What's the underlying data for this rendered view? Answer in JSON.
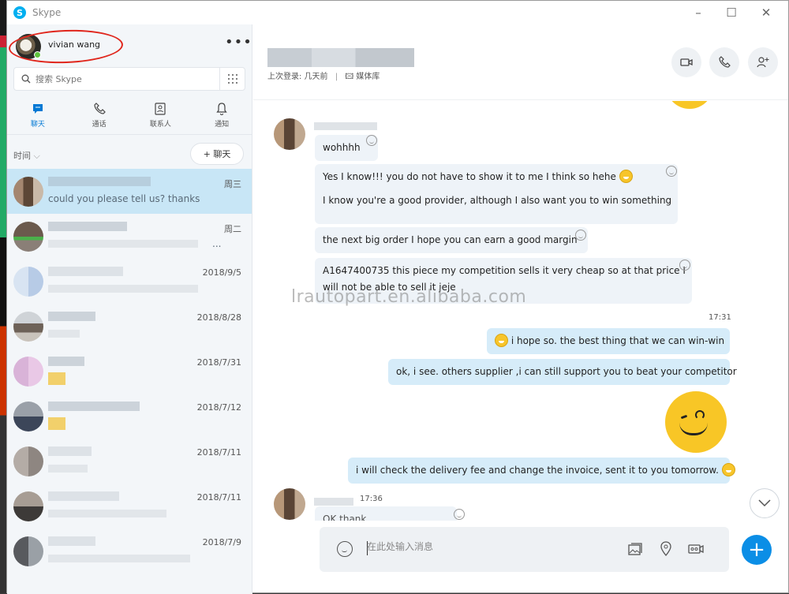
{
  "window": {
    "title": "Skype"
  },
  "profile": {
    "name": "vivian wang"
  },
  "search": {
    "placeholder": "搜索 Skype"
  },
  "tabs": [
    {
      "label": "聊天",
      "icon": "chat-icon"
    },
    {
      "label": "通话",
      "icon": "phone-icon"
    },
    {
      "label": "联系人",
      "icon": "contacts-icon"
    },
    {
      "label": "通知",
      "icon": "bell-icon"
    }
  ],
  "filter": {
    "label": "时间",
    "new_chat": "+ 聊天"
  },
  "chats": [
    {
      "preview": "could you please tell us? thanks",
      "date": "周三"
    },
    {
      "preview": "...",
      "date": "周二"
    },
    {
      "preview": "",
      "date": "2018/9/5"
    },
    {
      "preview": "",
      "date": "2018/8/28"
    },
    {
      "preview": "",
      "date": "2018/7/31"
    },
    {
      "preview": "",
      "date": "2018/7/12"
    },
    {
      "preview": "",
      "date": "2018/7/11"
    },
    {
      "preview": "",
      "date": "2018/7/11"
    },
    {
      "preview": "",
      "date": "2018/7/9"
    }
  ],
  "header": {
    "last_seen": "上次登录: 几天前",
    "media": "媒体库"
  },
  "messages": {
    "m1": "wohhhh",
    "m2a": "Yes I know!!! you do not have to show it to me I think so hehe",
    "m2b": "I know you're a good provider, although I also want you to win something",
    "m3": "the next big order I hope you can earn a good margin",
    "m4a": "A1647400735 this piece my competition sells it very cheap so at that price I",
    "m4b": "will not be able to sell it jeje",
    "time1": "17:31",
    "out1": "i hope so. the best thing that we can win-win",
    "out2": "ok, i see. others supplier ,i can still support you to beat your competitor",
    "out3": "i will check the delivery fee and change the invoice, sent it to you tomorrow.",
    "time2": "17:36",
    "m5": "OK thank..."
  },
  "watermark": "lrautopart.en.alibaba.com",
  "composer": {
    "placeholder": "在此处输入消息"
  },
  "colors": {
    "accent": "#0078d4",
    "active_chat": "#c8e6f6",
    "outgoing_bubble": "#d6ecf9",
    "incoming_bubble": "#eef3f8"
  }
}
